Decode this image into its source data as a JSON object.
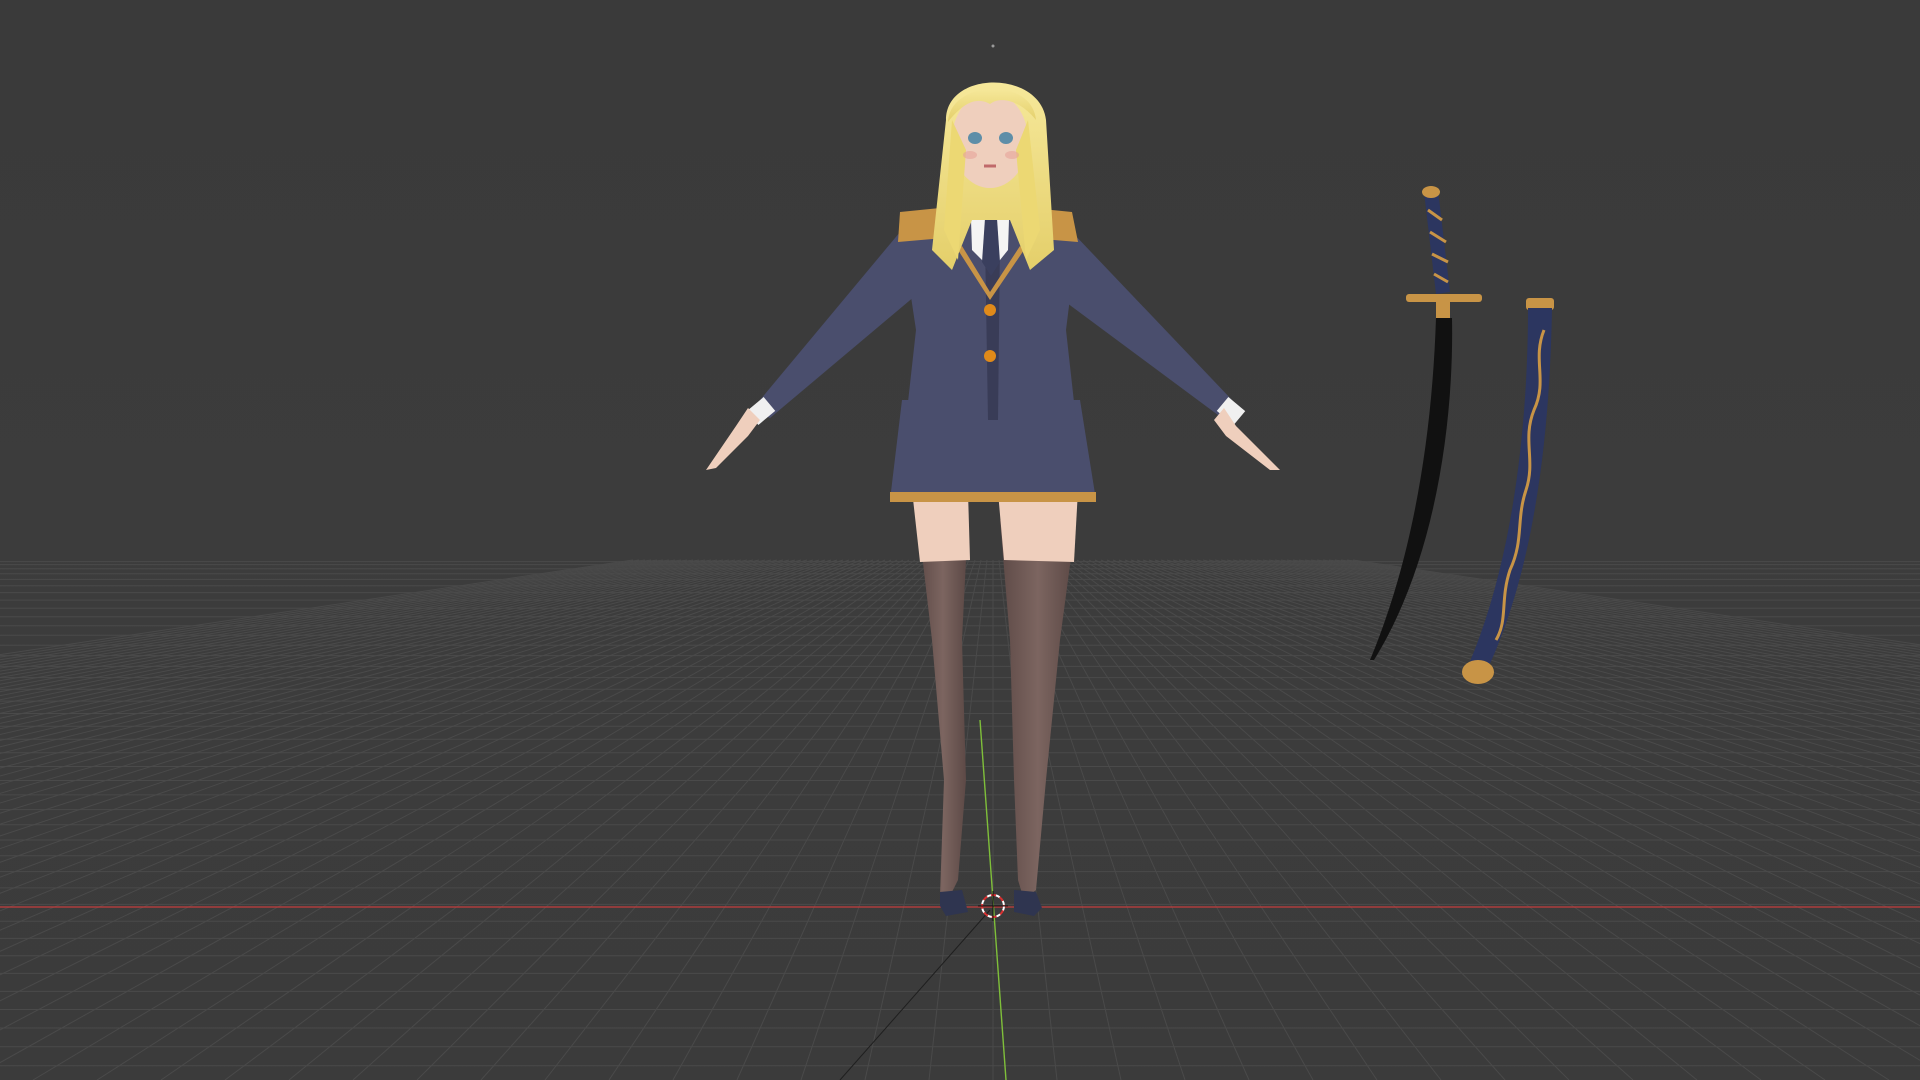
{
  "viewport": {
    "background_color": "#3a3a3a",
    "horizon_color": "#3c3c3c",
    "grid_line_color": "#4a4a4a",
    "x_axis_color": "#c43c3c",
    "y_axis_color": "#7fbf3a",
    "grid_visible": true
  },
  "scene_objects": [
    {
      "name": "character",
      "type": "mesh",
      "description_icon": "person-icon"
    },
    {
      "name": "katana",
      "type": "mesh",
      "description_icon": "sword-icon"
    },
    {
      "name": "scabbard",
      "type": "mesh",
      "description_icon": "scabbard-icon"
    },
    {
      "name": "3d-cursor",
      "type": "cursor",
      "description_icon": "crosshair-icon"
    }
  ],
  "colors": {
    "hair": "#f1e08a",
    "skin": "#efcfbd",
    "uniform": "#4a4e6d",
    "uniform_dark": "#393c57",
    "gold_trim": "#c89446",
    "stockings": "#6a5552",
    "shoes": "#2f3550",
    "blade": "#111111",
    "scabbard": "#2c3660"
  }
}
